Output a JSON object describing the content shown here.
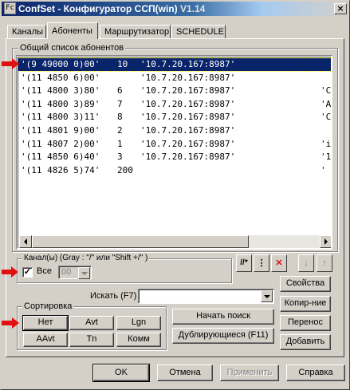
{
  "window": {
    "title": "ConfSet - Конфигуратор ССП(win)",
    "version": "V1.14",
    "close_glyph": "×"
  },
  "tabs": [
    {
      "label": "Каналы",
      "active": false
    },
    {
      "label": "Абоненты",
      "active": true
    },
    {
      "label": "Маршрутизатор",
      "active": false
    },
    {
      "label": "SCHEDULE",
      "active": false
    }
  ],
  "subscribers": {
    "group_label": "Общий список абонентов",
    "rows": [
      {
        "addr": "'(9 49000 0)00'",
        "num": "10",
        "ip": "'10.7.20.167:8987'",
        "extra": "",
        "selected": true
      },
      {
        "addr": "'(11 4850 6)00'",
        "num": "",
        "ip": "'10.7.20.167:8987'",
        "extra": "",
        "selected": false
      },
      {
        "addr": "'(11 4800 3)80'",
        "num": "6",
        "ip": "'10.7.20.167:8987'",
        "extra": "'C",
        "selected": false
      },
      {
        "addr": "'(11 4800 3)89'",
        "num": "7",
        "ip": "'10.7.20.167:8987'",
        "extra": "'A",
        "selected": false
      },
      {
        "addr": "'(11 4800 3)11'",
        "num": "8",
        "ip": "'10.7.20.167:8987'",
        "extra": "'C",
        "selected": false
      },
      {
        "addr": "'(11 4801 9)00'",
        "num": "2",
        "ip": "'10.7.20.167:8987'",
        "extra": "",
        "selected": false
      },
      {
        "addr": "'(11 4807 2)00'",
        "num": "1",
        "ip": "'10.7.20.167:8987'",
        "extra": "'i",
        "selected": false
      },
      {
        "addr": "'(11 4850 6)40'",
        "num": "3",
        "ip": "'10.7.20.167:8987'",
        "extra": "'1",
        "selected": false
      },
      {
        "addr": "'(11 4826 5)74'",
        "num": "200",
        "ip": "",
        "extra": "'",
        "selected": false
      }
    ]
  },
  "channels": {
    "group_label": "Канал(ы)  (Gray : \"/\" или \"Shift +/\" )",
    "all_label": "Все",
    "all_checked": true,
    "check_glyph": "✓",
    "select_value": "00"
  },
  "toolbar": {
    "mode_glyph": "//*",
    "sep_glyph": "⋮",
    "delete_glyph": "✕",
    "down_glyph": "↓",
    "up_glyph": "↑"
  },
  "search": {
    "label": "Искать (F7)",
    "value": "",
    "find_button": "Начать поиск",
    "duplicates_button": "Дублирующиеся (F11)"
  },
  "sort": {
    "group_label": "Сортировка",
    "buttons": [
      "Нет",
      "Avt",
      "Lgn",
      "AAvt",
      "Tn",
      "Комм"
    ]
  },
  "side_buttons": {
    "properties": "Свойства",
    "copy": "Копир-ние",
    "move": "Перенос",
    "add": "Добавить"
  },
  "footer": {
    "ok": "OK",
    "cancel": "Отмена",
    "apply": "Применить",
    "help": "Справка"
  },
  "colors": {
    "selection": "#0a246a",
    "annotation_arrow": "#e01010",
    "delete_icon": "#e01010"
  }
}
